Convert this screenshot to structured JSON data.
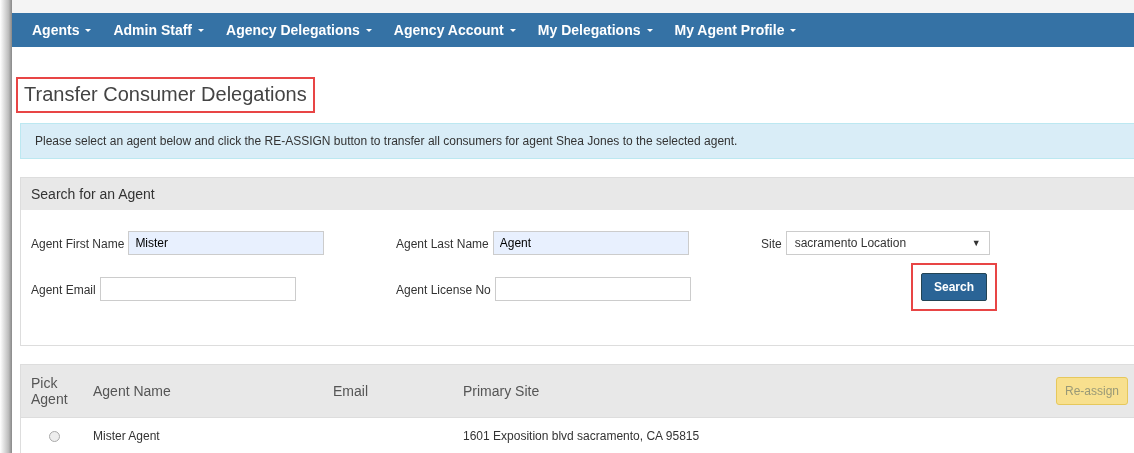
{
  "navbar": {
    "items": [
      {
        "label": "Agents",
        "dropdown": true
      },
      {
        "label": "Admin Staff",
        "dropdown": true
      },
      {
        "label": "Agency Delegations",
        "dropdown": true
      },
      {
        "label": "Agency Account",
        "dropdown": true
      },
      {
        "label": "My Delegations",
        "dropdown": true
      },
      {
        "label": "My Agent Profile",
        "dropdown": true
      }
    ]
  },
  "page_title": {
    "text": "Transfer Consumer Delegations",
    "highlighted": true
  },
  "alert": "Please select an agent below and click the RE-ASSIGN button to transfer all consumers for agent Shea Jones to the selected agent.",
  "search_panel": {
    "heading": "Search for an Agent",
    "fields": [
      {
        "label": "Agent First Name",
        "value": "Mister",
        "autofilled": true
      },
      {
        "label": "Agent Last Name",
        "value": "Agent",
        "autofilled": true
      },
      {
        "label": "Site",
        "value": "sacramento Location",
        "arrow": "▼",
        "kind": "select"
      },
      {
        "label": "Agent Email",
        "autofilled": false
      },
      {
        "label": "Agent License No",
        "autofilled": false
      }
    ],
    "search_button": {
      "label": "Search",
      "highlighted": true
    }
  },
  "table": {
    "columns": [
      "Pick Agent",
      "Agent Name",
      "Email",
      "Primary Site"
    ],
    "reassign_button": {
      "label": "Re-assign",
      "disabled": true
    },
    "rows": [
      {
        "selected": false,
        "agent_name": "Mister Agent",
        "primary_site": "1601 Exposition blvd sacramento, CA 95815"
      }
    ]
  }
}
